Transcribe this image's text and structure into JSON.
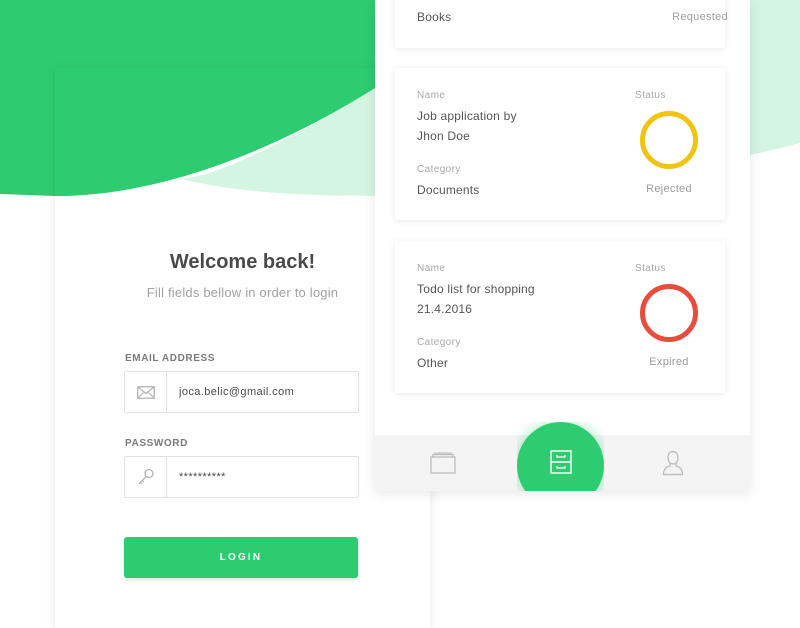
{
  "login": {
    "title": "Welcome back!",
    "subtitle": "Fill fields bellow in order to login",
    "email_label": "EMAIL ADDRESS",
    "email_value": "joca.belic@gmail.com",
    "password_label": "PASSWORD",
    "password_value": "**********",
    "login_button": "LOGIN"
  },
  "list": {
    "top_item": {
      "name": "Books",
      "status": "Requested"
    },
    "items": [
      {
        "name_label": "Name",
        "name_line1": "Job application by",
        "name_line2": "Jhon Doe",
        "category_label": "Category",
        "category": "Documents",
        "status_label": "Status",
        "status": "Rejected",
        "status_color": "#f1c40f"
      },
      {
        "name_label": "Name",
        "name_line1": "Todo list for shopping",
        "name_line2": "21.4.2016",
        "category_label": "Category",
        "category": "Other",
        "status_label": "Status",
        "status": "Expired",
        "status_color": "#e74c3c"
      }
    ]
  },
  "nav": {
    "items": [
      {
        "icon": "folder-icon"
      },
      {
        "icon": "archive-cabinet-icon",
        "active": true
      },
      {
        "icon": "user-icon"
      }
    ]
  },
  "colors": {
    "accent": "#2ecc71",
    "accent_light": "#d5f5e3",
    "warning": "#f1c40f",
    "danger": "#e74c3c"
  }
}
